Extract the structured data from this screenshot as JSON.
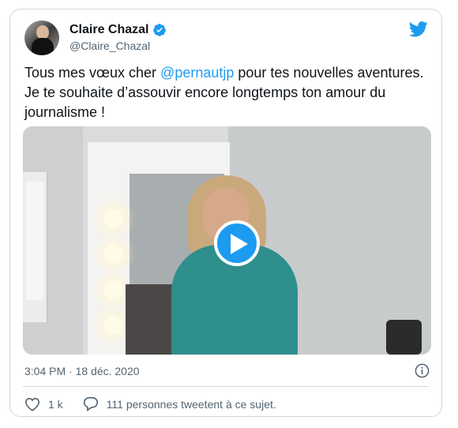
{
  "author": {
    "name": "Claire Chazal",
    "handle": "@Claire_Chazal",
    "verified_icon": "verified-badge-icon"
  },
  "brand_icon": "twitter-bird-icon",
  "tweet": {
    "text_before": "Tous mes vœux cher ",
    "mention": "@pernautjp",
    "text_after": " pour tes nouvelles aventures. Je te souhaite d’assouvir encore  longtemps ton amour du journalisme !"
  },
  "media": {
    "type": "video",
    "play_icon": "play-icon"
  },
  "meta": {
    "timestamp": "3:04 PM · 18 déc. 2020",
    "info_icon": "info-icon"
  },
  "actions": {
    "likes": "1 k",
    "replies_text": "111 personnes tweetent à ce sujet."
  },
  "colors": {
    "accent": "#1d9bf0",
    "text": "#0f1419",
    "secondary": "#536471",
    "border": "#cfd9de"
  }
}
